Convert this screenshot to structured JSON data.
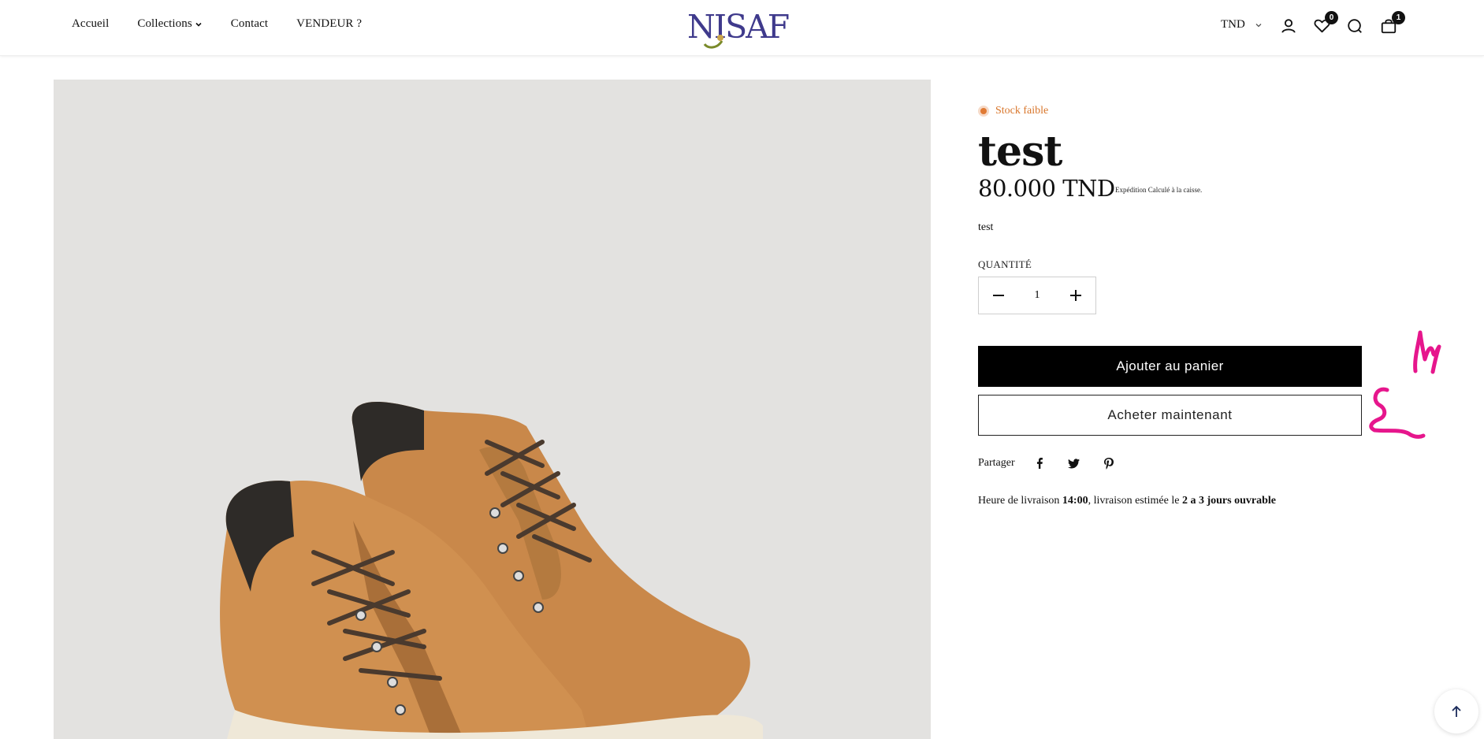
{
  "nav": {
    "items": [
      {
        "label": "Accueil"
      },
      {
        "label": "Collections"
      },
      {
        "label": "Contact"
      },
      {
        "label": "VENDEUR ?"
      }
    ]
  },
  "logo": {
    "text": "NISAF"
  },
  "header": {
    "currency": "TND",
    "wishlist_count": "0",
    "cart_count": "1"
  },
  "product": {
    "stock_status": "Stock faible",
    "title": "test",
    "price": "80.000 TND",
    "shipping_note": "Expédition Calculé à la caisse.",
    "description": "test",
    "quantity_label": "QUANTITÉ",
    "quantity": "1",
    "add_to_cart": "Ajouter au panier",
    "buy_now": "Acheter maintenant",
    "share_label": "Partager",
    "delivery": {
      "prefix": "Heure de livraison ",
      "time": "14:00",
      "middle": ", livraison estimée le ",
      "estimate": "2 a 3 jours ouvrable"
    }
  },
  "colors": {
    "accent": "#000000",
    "stock_low": "#e07a34",
    "logo": "#3f3a8c",
    "annotation": "#e6168c",
    "image_bg": "#e3e2e0"
  },
  "icons": {
    "account": "user-icon",
    "wishlist": "heart-icon",
    "search": "search-icon",
    "cart": "bag-icon",
    "share": [
      "facebook-icon",
      "twitter-icon",
      "pinterest-icon"
    ],
    "scroll_top": "arrow-up-icon"
  }
}
